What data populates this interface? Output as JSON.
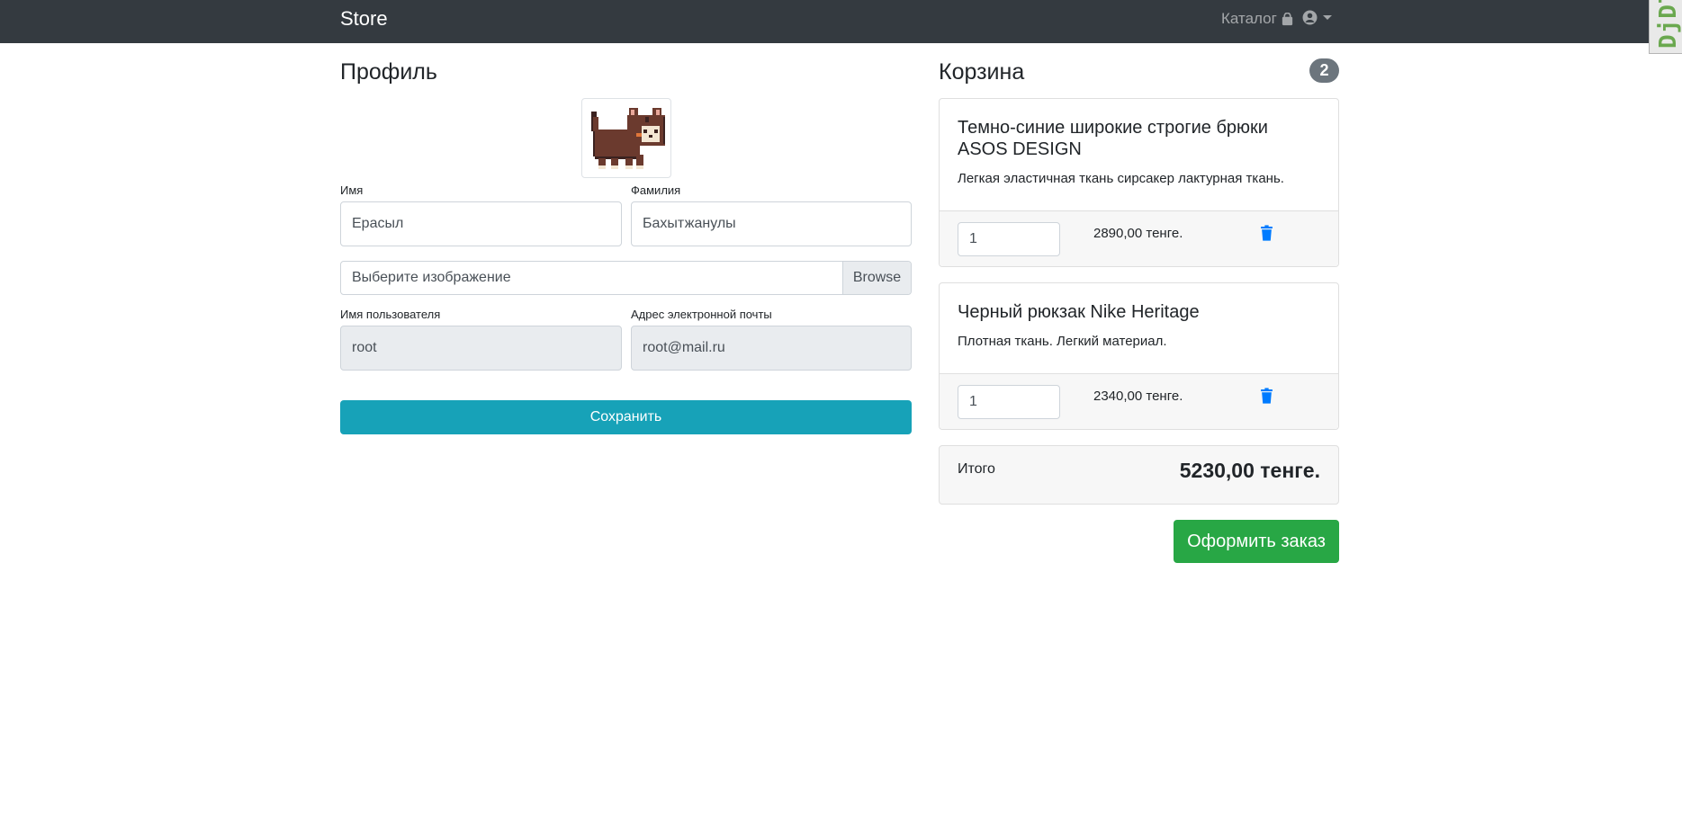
{
  "navbar": {
    "brand": "Store",
    "catalog_label": "Каталог",
    "corner_logo_text": "DjDT"
  },
  "profile": {
    "title": "Профиль",
    "avatar_alt": "pixel cat avatar",
    "first_name_label": "Имя",
    "first_name_value": "Ерасыл",
    "last_name_label": "Фамилия",
    "last_name_value": "Бахытжанулы",
    "image_placeholder": "Выберите изображение",
    "browse_label": "Browse",
    "username_label": "Имя пользователя",
    "username_value": "root",
    "email_label": "Адрес электронной почты",
    "email_value": "root@mail.ru",
    "save_label": "Сохранить"
  },
  "cart": {
    "title": "Корзина",
    "count": "2",
    "items": [
      {
        "name": "Темно-синие широкие строгие брюки ASOS DESIGN",
        "description": "Легкая эластичная ткань сирсакер лактурная ткань.",
        "quantity": "1",
        "price": "2890,00 тенге."
      },
      {
        "name": "Черный рюкзак Nike Heritage",
        "description": "Плотная ткань. Легкий материал.",
        "quantity": "1",
        "price": "2340,00 тенге."
      }
    ],
    "total_label": "Итого",
    "total_value": "5230,00 тенге.",
    "checkout_label": "Оформить заказ"
  },
  "colors": {
    "navbar": "#343a40",
    "info": "#17a2b8",
    "success": "#28a745",
    "primary": "#007bff",
    "badge": "#6c757d"
  },
  "icons": {
    "catalog": "shopping-bag-icon",
    "user": "user-circle-icon",
    "delete": "trash-icon"
  }
}
